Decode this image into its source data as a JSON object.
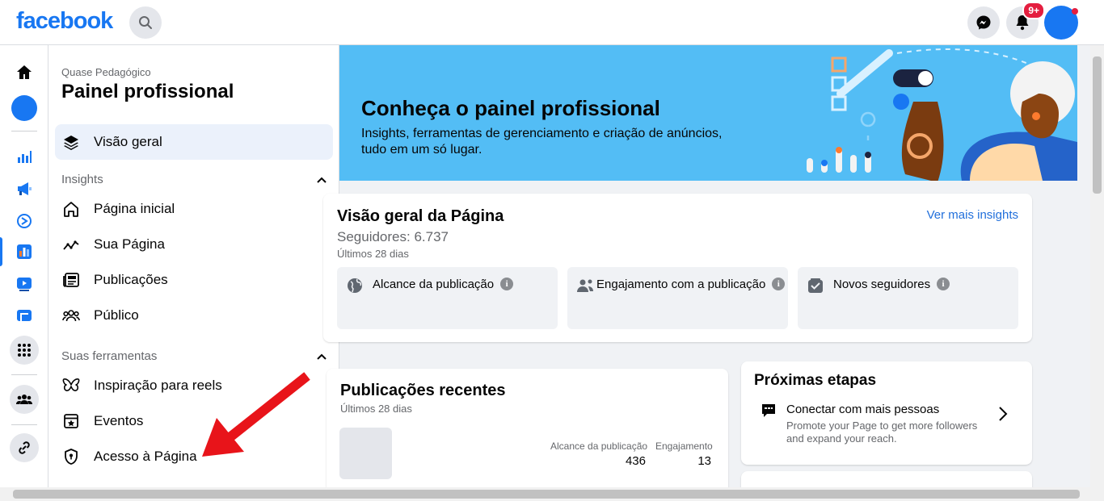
{
  "topbar": {
    "logo": "facebook",
    "notifications_badge": "9+"
  },
  "panel": {
    "page_name": "Quase Pedagógico",
    "title": "Painel profissional",
    "overview": "Visão geral",
    "insights_section": "Insights",
    "insights_items": [
      "Página inicial",
      "Sua Página",
      "Publicações",
      "Público"
    ],
    "tools_section": "Suas ferramentas",
    "tools_items": [
      "Inspiração para reels",
      "Eventos",
      "Acesso à Página"
    ]
  },
  "banner": {
    "title": "Conheça o painel profissional",
    "text": "Insights, ferramentas de gerenciamento e criação de anúncios, tudo em um só lugar."
  },
  "overview_card": {
    "title": "Visão geral da Página",
    "followers": "Seguidores: 6.737",
    "period": "Últimos 28 dias",
    "link": "Ver mais insights",
    "metrics": [
      "Alcance da publicação",
      "Engajamento com a publicação",
      "Novos seguidores"
    ]
  },
  "recent_card": {
    "title": "Publicações recentes",
    "period": "Últimos 28 dias",
    "col_reach": "Alcance da publicação",
    "col_engagement": "Engajamento",
    "reach_value": "436",
    "engagement_value": "13"
  },
  "next_card": {
    "title": "Próximas etapas",
    "item_title": "Conectar com mais pessoas",
    "item_desc": "Promote your Page to get more followers and expand your reach."
  },
  "colors": {
    "brand": "#1877f2",
    "banner": "#53bdf5",
    "arrow": "#e8141a"
  }
}
